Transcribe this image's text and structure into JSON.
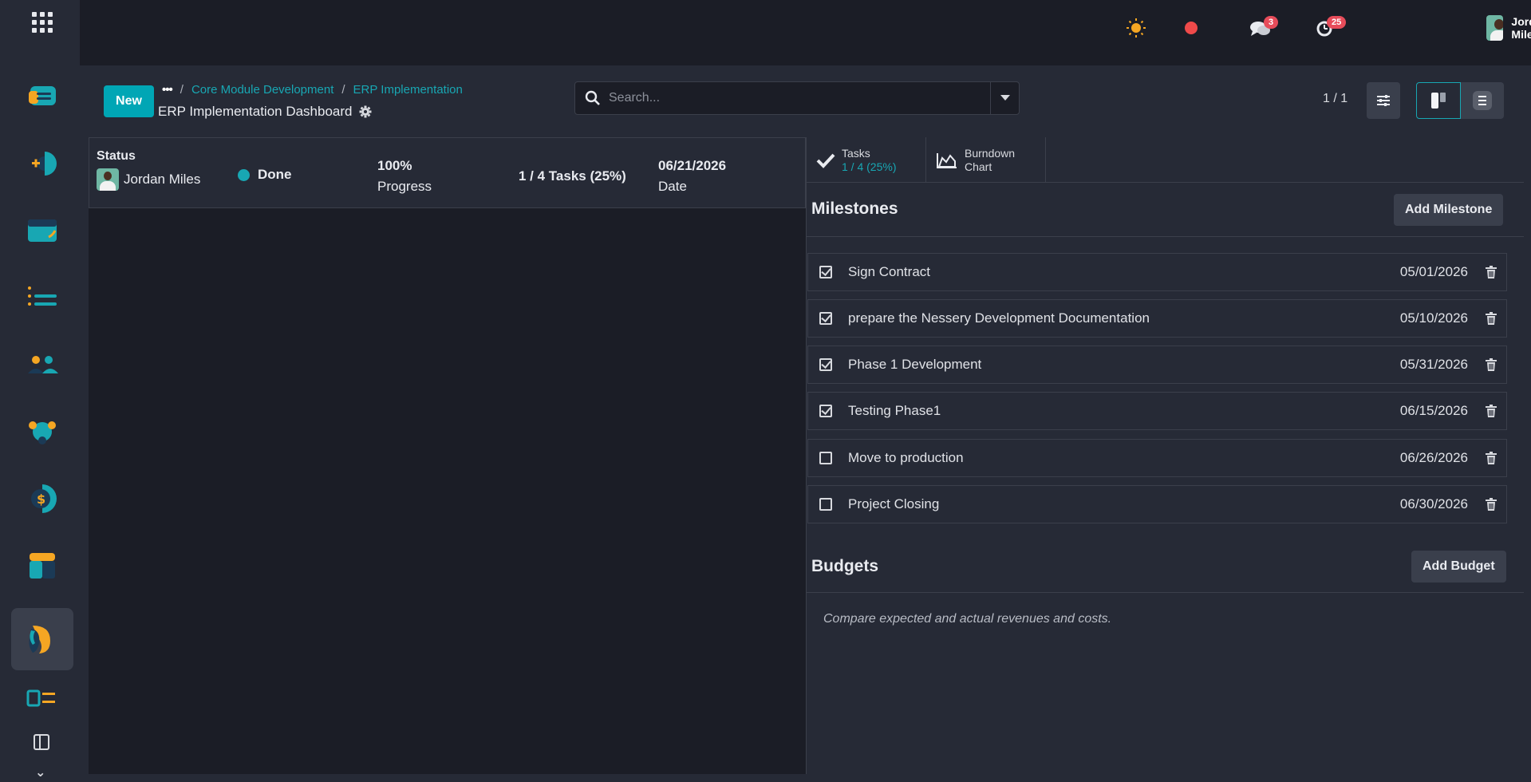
{
  "topbar": {
    "user_name": "Jordan Miles",
    "messages_count": "3",
    "activities_count": "25"
  },
  "control": {
    "new_label": "New",
    "breadcrumbs": [
      "Core Module Development",
      "ERP Implementation"
    ],
    "page_title": "ERP Implementation Dashboard",
    "search_placeholder": "Search...",
    "pager": "1 / 1"
  },
  "status": {
    "label": "Status",
    "user": "Jordan Miles",
    "state": "Done",
    "progress_value": "100%",
    "progress_label": "Progress",
    "tasks": "1 / 4 Tasks (25%)",
    "date_value": "06/21/2026",
    "date_label": "Date"
  },
  "tabs": {
    "tasks_label": "Tasks",
    "tasks_sub": "1 / 4 (25%)",
    "burndown_line1": "Burndown",
    "burndown_line2": "Chart"
  },
  "milestones": {
    "title": "Milestones",
    "add_label": "Add Milestone",
    "items": [
      {
        "name": "Sign Contract",
        "date": "05/01/2026",
        "done": true
      },
      {
        "name": "prepare the Nessery Development Documentation",
        "date": "05/10/2026",
        "done": true
      },
      {
        "name": "Phase 1 Development",
        "date": "05/31/2026",
        "done": true
      },
      {
        "name": "Testing Phase1",
        "date": "06/15/2026",
        "done": true
      },
      {
        "name": "Move to production",
        "date": "06/26/2026",
        "done": false
      },
      {
        "name": "Project Closing",
        "date": "06/30/2026",
        "done": false
      }
    ]
  },
  "budgets": {
    "title": "Budgets",
    "add_label": "Add Budget",
    "description": "Compare expected and actual revenues and costs."
  },
  "colors": {
    "accent": "#18a7b3",
    "primary_button": "#00a6b5",
    "badge": "#e74c5a",
    "record_dot": "#ef4a4a",
    "sun": "#f5a623"
  }
}
